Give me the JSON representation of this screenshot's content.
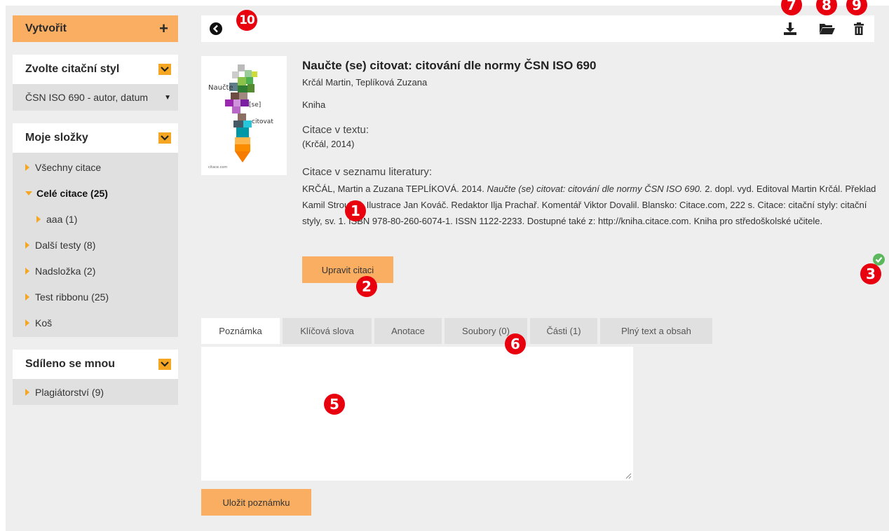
{
  "sidebar": {
    "create_label": "Vytvořit",
    "create_icon": "plus-icon",
    "citation_style_heading": "Zvolte citační styl",
    "citation_style_value": "ČSN ISO 690 - autor, datum",
    "folders_heading": "Moje složky",
    "folders": [
      {
        "label": "Všechny citace"
      },
      {
        "label": "Celé citace (25)"
      },
      {
        "label": "aaa (1)"
      },
      {
        "label": "Další testy (8)"
      },
      {
        "label": "Nadsložka (2)"
      },
      {
        "label": "Test ribbonu (25)"
      },
      {
        "label": "Koš"
      }
    ],
    "shared_heading": "Sdíleno se mnou",
    "shared": [
      {
        "label": "Plagiátorství (9)"
      }
    ]
  },
  "toolbar": {
    "back_icon": "arrow-left-circle-icon",
    "download_icon": "download-icon",
    "folder_icon": "folder-open-icon",
    "delete_icon": "trash-icon"
  },
  "callouts": [
    "1",
    "2",
    "3",
    "5",
    "6",
    "7",
    "8",
    "9",
    "10"
  ],
  "book": {
    "cover_text": [
      "Naučte",
      "[se]",
      "citovat",
      "citace.com"
    ],
    "title": "Naučte (se) citovat: citování dle normy ČSN ISO 690",
    "authors": "Krčál Martin, Teplíková Zuzana",
    "type": "Kniha",
    "in_text_label": "Citace v textu:",
    "in_text": "(Krčál, 2014)",
    "bib_label": "Citace v seznamu literatury:",
    "bib_pre": "KRČÁL, Martin a Zuzana TEPLÍKOVÁ. 2014. ",
    "bib_title": "Naučte (se) citovat: citování dle normy ČSN ISO 690.",
    "bib_post": " 2. dopl. vyd. Editoval Martin Krčál. Překlad Kamil Strouhal. Ilustrace Jan Kováč. Redaktor Ilja Prachař. Komentář Viktor Dovalil. Blansko: Citace.com, 222 s. Citace: citační styly: citační styly, sv. 1. ISBN 978-80-260-6074-1. ISSN 1122-2233. Dostupné také z: http://kniha.citace.com. Kniha pro středoškolské učitele.",
    "edit_label": "Upravit citaci",
    "status_icon": "check-circle-icon",
    "status_color": "#5cb85c"
  },
  "tabs": [
    {
      "label": "Poznámka"
    },
    {
      "label": "Klíčová slova"
    },
    {
      "label": "Anotace"
    },
    {
      "label": "Soubory (0)"
    },
    {
      "label": "Části (1)"
    },
    {
      "label": "Plný text a obsah"
    }
  ],
  "note": {
    "value": "",
    "save_label": "Uložit poznámku"
  },
  "colors": {
    "accent": "#f9ae62",
    "toggle": "#f5a623",
    "badge": "#e8000e",
    "background": "#eeeeee"
  }
}
